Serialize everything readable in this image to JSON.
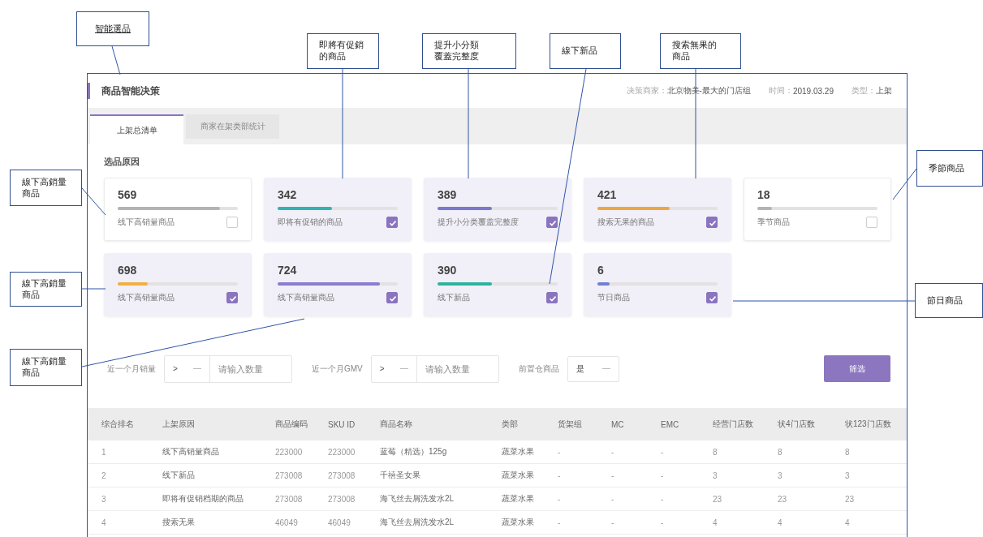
{
  "callouts": [
    {
      "kind": "link",
      "text": "智能選品"
    },
    {
      "kind": "note",
      "text": "即將有促銷的商品"
    },
    {
      "kind": "note",
      "text": "提升小分類覆蓋完整度"
    },
    {
      "kind": "note",
      "text": "線下新品"
    },
    {
      "kind": "note",
      "text": "搜索無果的商品"
    },
    {
      "kind": "note",
      "text": "季節商品"
    },
    {
      "kind": "note",
      "text": "線下高銷量商品"
    },
    {
      "kind": "note",
      "text": "線下高銷量商品"
    },
    {
      "kind": "note",
      "text": "線下高銷量商品"
    },
    {
      "kind": "note",
      "text": "節日商品"
    }
  ],
  "page": {
    "title": "商品智能决策",
    "meta": [
      {
        "label": "决策商家：",
        "value": "北京物美-最大的门店组"
      },
      {
        "label": "时间：",
        "value": "2019.03.29"
      },
      {
        "label": "类型：",
        "value": "上架"
      }
    ],
    "tabs": [
      {
        "label": "上架总清单",
        "selected": true
      },
      {
        "label": "商家在架类部统计",
        "selected": false
      }
    ],
    "section_title": "选品原因",
    "cards": [
      {
        "count": "569",
        "level": 0.85,
        "color": "#b4b4b4",
        "label": "线下高销量商品",
        "checked": false
      },
      {
        "count": "342",
        "level": 0.45,
        "color": "#2fb3b3",
        "label": "即将有促销的商品",
        "checked": true
      },
      {
        "count": "389",
        "level": 0.45,
        "color": "#7a78d0",
        "label": "提升小分类覆盖完整度",
        "checked": true
      },
      {
        "count": "421",
        "level": 0.6,
        "color": "#f0a640",
        "label": "搜索无果的商品",
        "checked": true
      },
      {
        "count": "18",
        "level": 0.12,
        "color": "#b4b4b4",
        "label": "季节商品",
        "checked": false
      },
      {
        "count": "698",
        "level": 0.25,
        "color": "#f0b040",
        "label": "线下高销量商品",
        "checked": true
      },
      {
        "count": "724",
        "level": 0.85,
        "color": "#8a7cd0",
        "label": "线下高销量商品",
        "checked": true
      },
      {
        "count": "390",
        "level": 0.45,
        "color": "#2fb3a0",
        "label": "线下新品",
        "checked": true
      },
      {
        "count": "6",
        "level": 0.1,
        "color": "#6f7fd6",
        "label": "节日商品",
        "checked": true
      }
    ],
    "filters": [
      {
        "label": "近一个月销量",
        "operator": ">",
        "placeholder": "请输入数量"
      },
      {
        "label": "近一个月GMV",
        "operator": ">",
        "placeholder": "请输入数量"
      }
    ],
    "warehouse_filter": {
      "label": "前置仓商品",
      "value": "是"
    },
    "filter_button": "筛选",
    "table": {
      "columns": [
        "综合排名",
        "上架原因",
        "商品编码",
        "SKU ID",
        "商品名称",
        "类部",
        "货架组",
        "MC",
        "EMC",
        "经营门店数",
        "状4门店数",
        "状123门店数"
      ],
      "rows": [
        [
          "1",
          "线下高销量商品",
          "223000",
          "223000",
          "蓝莓（精选）125g",
          "蔬菜水果",
          "-",
          "-",
          "-",
          "8",
          "8",
          "8"
        ],
        [
          "2",
          "线下新品",
          "273008",
          "273008",
          "千禧圣女果",
          "蔬菜水果",
          "-",
          "-",
          "-",
          "3",
          "3",
          "3"
        ],
        [
          "3",
          "即将有促销档期的商品",
          "273008",
          "273008",
          "海飞丝去屑洗发水2L",
          "蔬菜水果",
          "-",
          "-",
          "-",
          "23",
          "23",
          "23"
        ],
        [
          "4",
          "搜索无果",
          "46049",
          "46049",
          "海飞丝去屑洗发水2L",
          "蔬菜水果",
          "-",
          "-",
          "-",
          "4",
          "4",
          "4"
        ]
      ]
    }
  }
}
